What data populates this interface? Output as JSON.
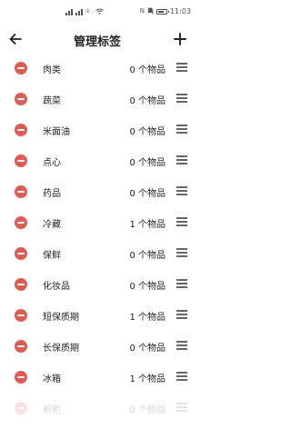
{
  "status": {
    "carrier": "令 ⋅",
    "time": "11:03",
    "battery": 0.8,
    "icons": [
      "signal-icon",
      "wifi-icon",
      "nfc-icon",
      "silent-icon",
      "battery-icon"
    ]
  },
  "header": {
    "title": "管理标签",
    "back_icon": "arrow-left-icon",
    "add_icon": "plus-icon"
  },
  "tags": [
    {
      "name": "肉类",
      "count": "0 个物品"
    },
    {
      "name": "蔬菜",
      "count": "0 个物品"
    },
    {
      "name": "米面油",
      "count": "0 个物品"
    },
    {
      "name": "点心",
      "count": "0 个物品"
    },
    {
      "name": "药品",
      "count": "0 个物品"
    },
    {
      "name": "冷藏",
      "count": "1 个物品"
    },
    {
      "name": "保鲜",
      "count": "0 个物品"
    },
    {
      "name": "化妆品",
      "count": "0 个物品"
    },
    {
      "name": "短保质期",
      "count": "1 个物品"
    },
    {
      "name": "长保质期",
      "count": "0 个物品"
    },
    {
      "name": "冰箱",
      "count": "1 个物品"
    },
    {
      "name": "橱柜",
      "count": "0 个物品"
    }
  ],
  "colors": {
    "remove": "#e25b52",
    "text": "#222222"
  }
}
